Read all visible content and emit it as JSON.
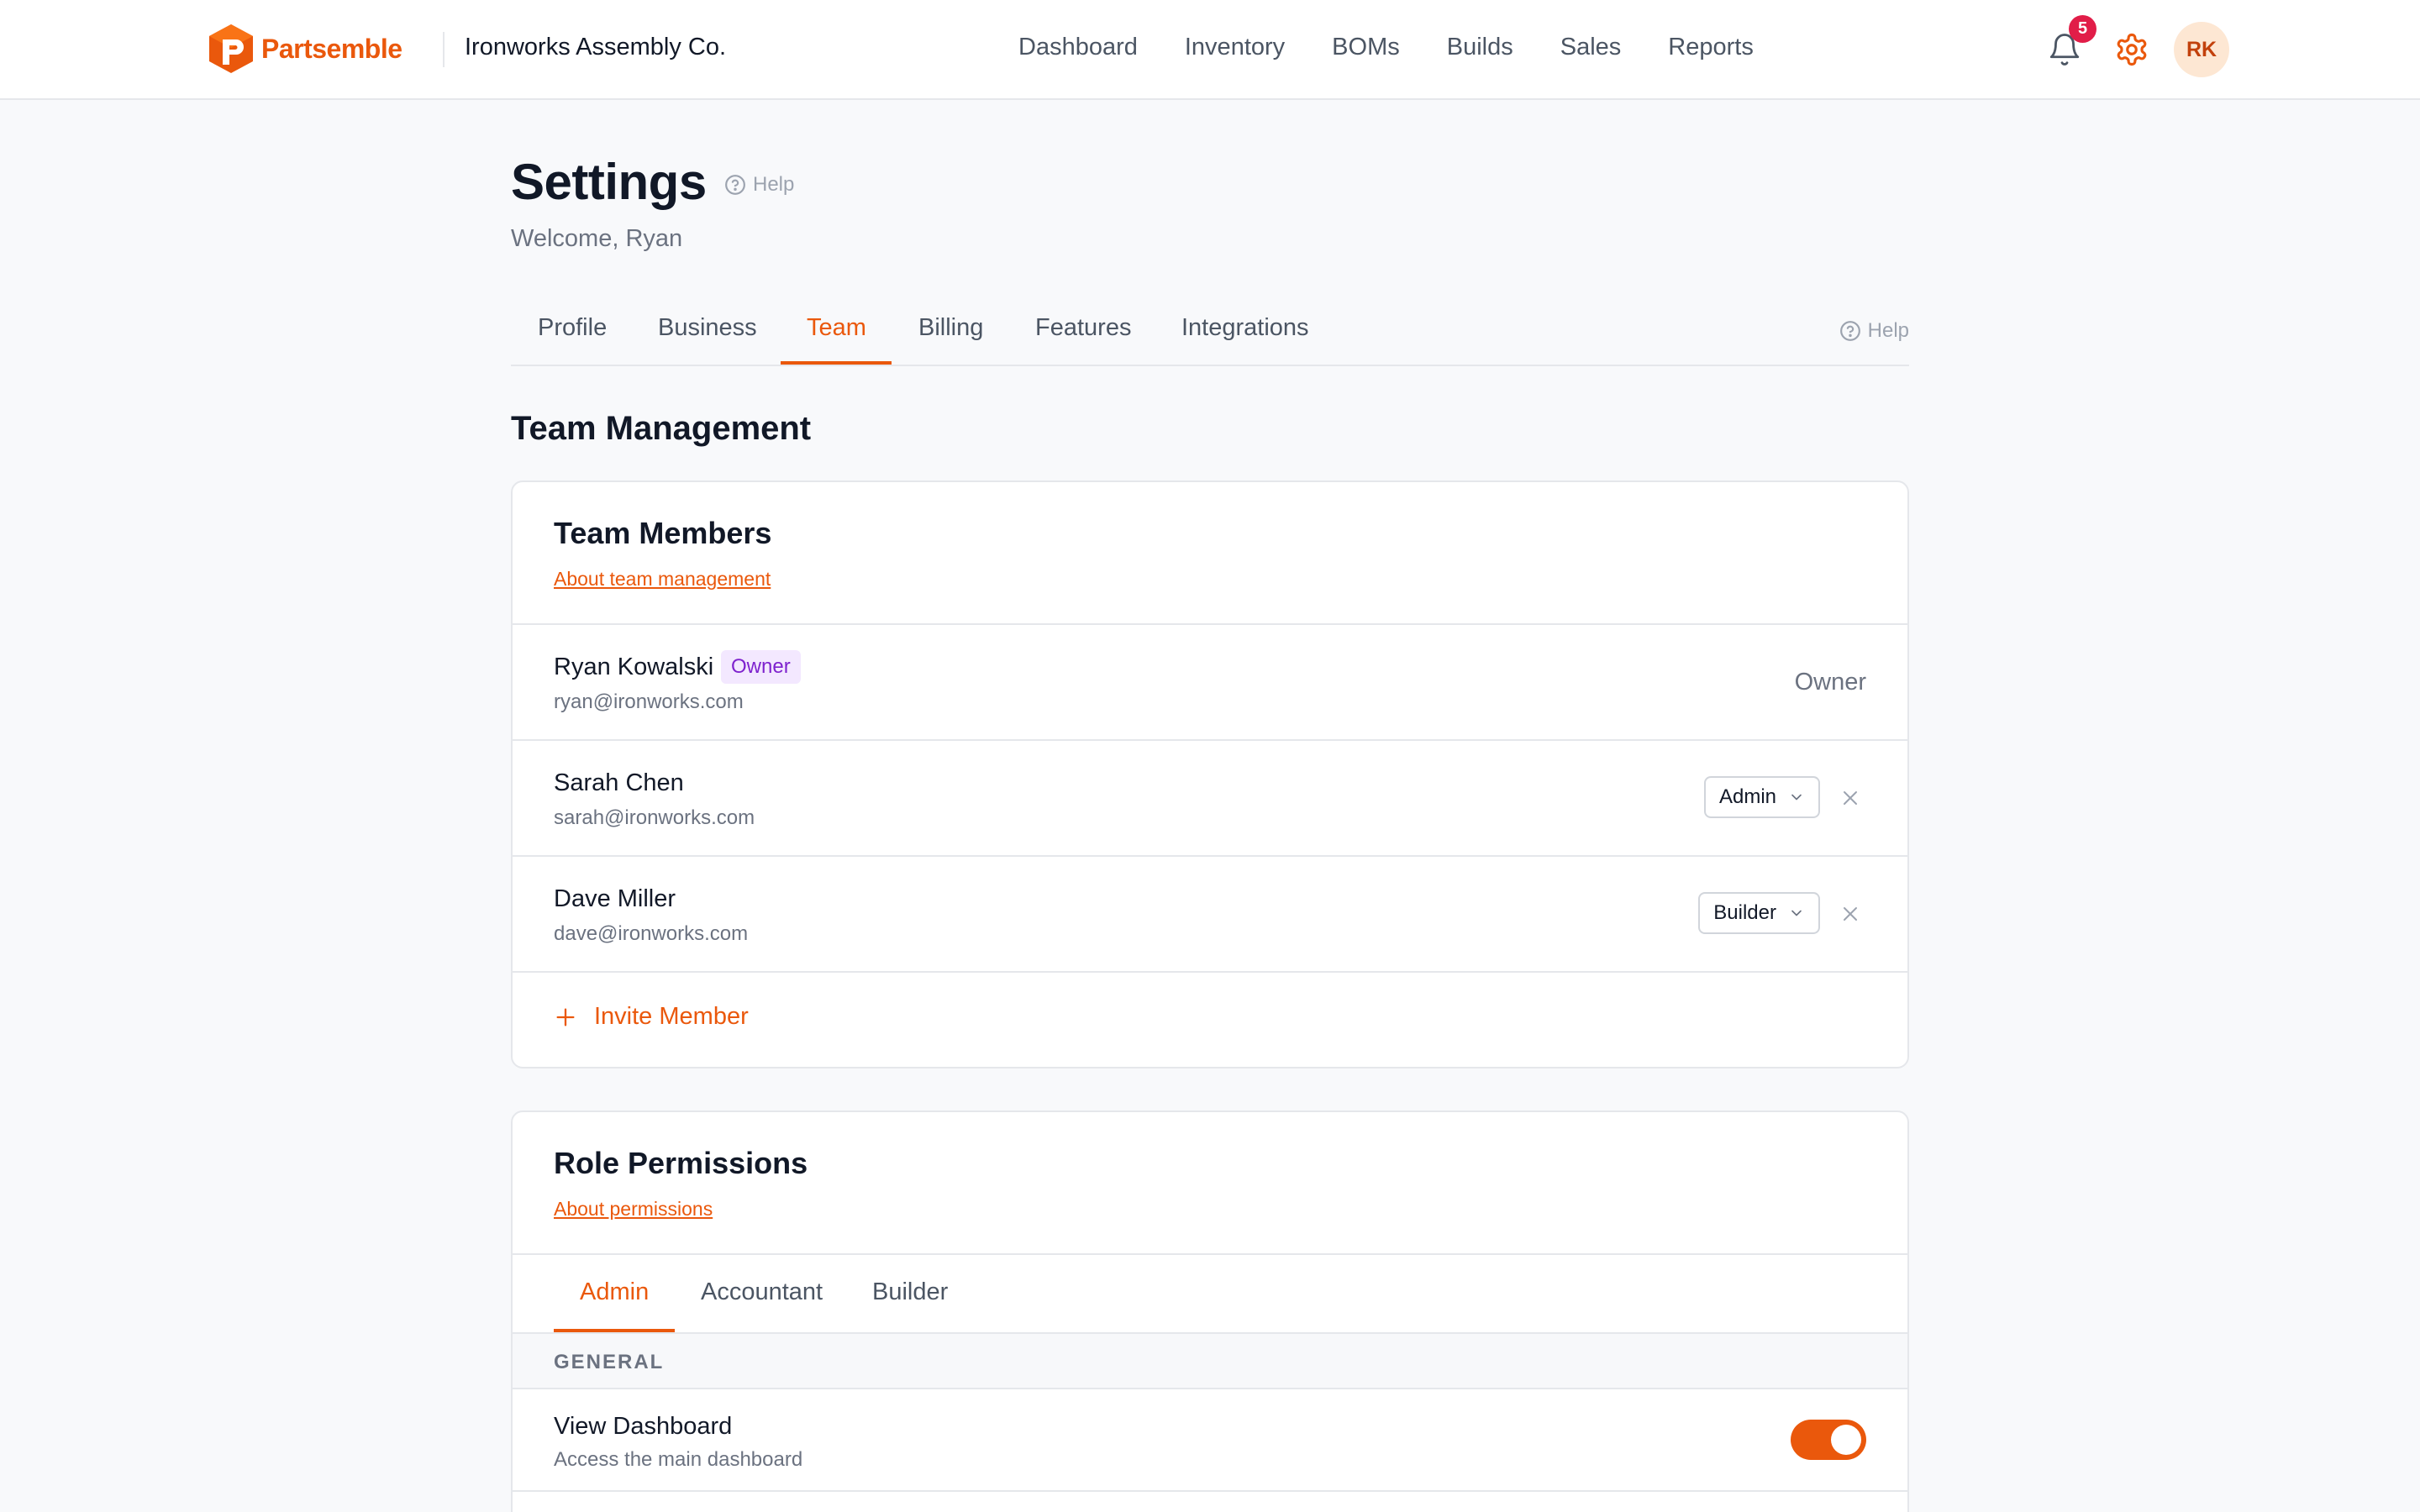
{
  "brand": {
    "name": "Partsemble",
    "company": "Ironworks Assembly Co."
  },
  "nav": {
    "links": [
      "Dashboard",
      "Inventory",
      "BOMs",
      "Builds",
      "Sales",
      "Reports"
    ],
    "notification_count": "5",
    "avatar_initials": "RK"
  },
  "page": {
    "title": "Settings",
    "help_label": "Help",
    "welcome": "Welcome, Ryan"
  },
  "tabs": {
    "items": [
      "Profile",
      "Business",
      "Team",
      "Billing",
      "Features",
      "Integrations"
    ],
    "active": "Team",
    "help_label": "Help"
  },
  "section_title": "Team Management",
  "team_card": {
    "title": "Team Members",
    "link": "About team management",
    "members": [
      {
        "name": "Ryan Kowalski",
        "email": "ryan@ironworks.com",
        "badge": "Owner",
        "role": "Owner"
      },
      {
        "name": "Sarah Chen",
        "email": "sarah@ironworks.com",
        "role": "Admin"
      },
      {
        "name": "Dave Miller",
        "email": "dave@ironworks.com",
        "role": "Builder"
      }
    ],
    "invite_label": "Invite Member"
  },
  "perm_card": {
    "title": "Role Permissions",
    "link": "About permissions",
    "tabs": [
      "Admin",
      "Accountant",
      "Builder"
    ],
    "active_tab": "Admin",
    "group": "GENERAL",
    "permissions": [
      {
        "name": "View Dashboard",
        "description": "Access the main dashboard",
        "enabled": true
      }
    ]
  },
  "colors": {
    "accent": "#ea580c",
    "badge_bg": "#f3e8ff",
    "badge_text": "#7e22ce",
    "notify": "#e11d48"
  }
}
